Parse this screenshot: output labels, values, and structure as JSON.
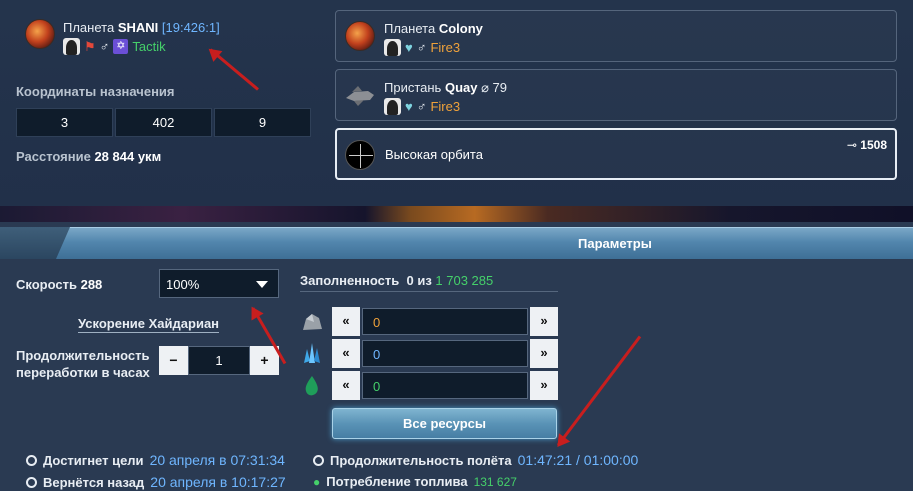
{
  "origin": {
    "prefix": "Планета",
    "name": "SHANI",
    "coords": "[19:426:1]",
    "player": "Tactik"
  },
  "destination": {
    "label": "Координаты назначения",
    "coords": [
      "3",
      "402",
      "9"
    ],
    "distance_label": "Расстояние",
    "distance_value": "28 844 укм"
  },
  "targets": [
    {
      "prefix": "Планета",
      "name": "Colony",
      "suffix": "",
      "player": "Fire3"
    },
    {
      "prefix": "Пристань",
      "name": "Quay",
      "suffix": "⌀ 79",
      "player": "Fire3"
    },
    {
      "name": "Высокая орбита",
      "count": "1508"
    }
  ],
  "params": {
    "title": "Параметры",
    "speed_label": "Скорость",
    "speed_value": "288",
    "speed_select": "100%",
    "acceleration": "Ускорение Хайдариан",
    "duration_label_line1": "Продолжительность",
    "duration_label_line2": "переработки в часах",
    "duration_value": "1",
    "minus": "−",
    "plus": "+",
    "fill_label": "Заполненность",
    "fill_current": "0 из",
    "fill_total": "1 703 285",
    "resources": [
      "0",
      "0",
      "0"
    ],
    "left_btn": "«",
    "right_btn": "»",
    "all_resources": "Все ресурсы"
  },
  "info": {
    "reach_label": "Достигнет цели",
    "reach_value": "20 апреля в 07:31:34",
    "return_label": "Вернётся назад",
    "return_value": "20 апреля в 10:17:27",
    "flight_label": "Продолжительность полёта",
    "flight_value": "01:47:21 / 01:00:00",
    "fuel_label": "Потребление топлива",
    "fuel_value": "131 627"
  },
  "colors": {
    "accent_blue": "#6fb6ff",
    "green": "#45d06a",
    "orange": "#f0a23a",
    "annotation_red": "#c81e1e"
  }
}
